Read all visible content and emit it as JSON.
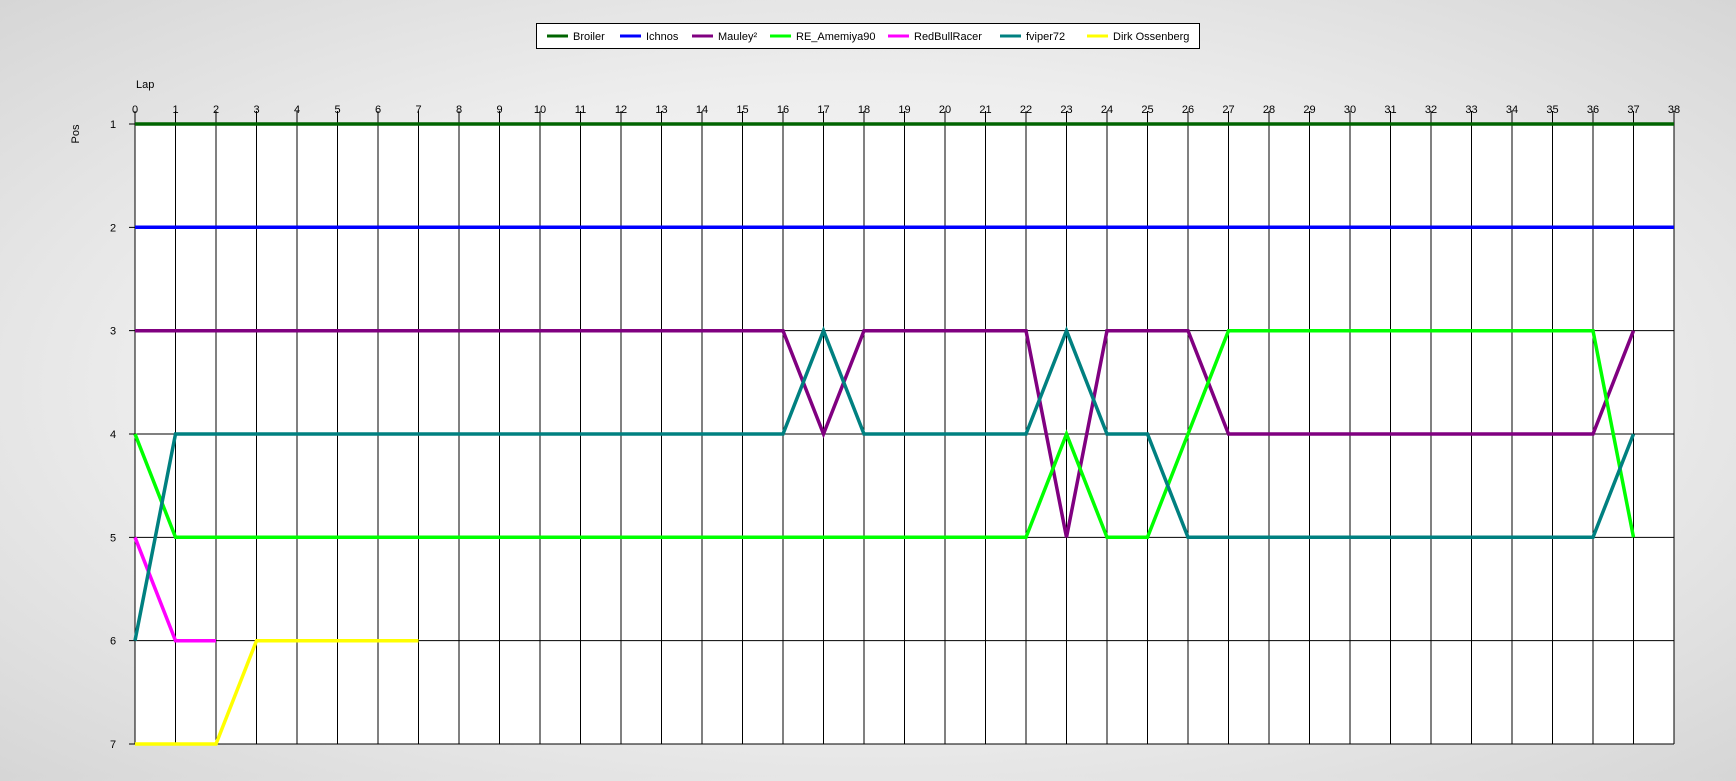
{
  "chart_data": {
    "type": "line",
    "title": "",
    "xlabel": "Lap",
    "ylabel": "Pos",
    "x": [
      0,
      1,
      2,
      3,
      4,
      5,
      6,
      7,
      8,
      9,
      10,
      11,
      12,
      13,
      14,
      15,
      16,
      17,
      18,
      19,
      20,
      21,
      22,
      23,
      24,
      25,
      26,
      27,
      28,
      29,
      30,
      31,
      32,
      33,
      34,
      35,
      36,
      37,
      38
    ],
    "xlim": [
      0,
      38
    ],
    "ylim": [
      1,
      7
    ],
    "y_inverted": true,
    "y_ticks": [
      1,
      2,
      3,
      4,
      5,
      6,
      7
    ],
    "grid": true,
    "legend_position": "top-center",
    "series": [
      {
        "name": "Broiler",
        "color": "#006400",
        "x": [
          0,
          1,
          2,
          3,
          4,
          5,
          6,
          7,
          8,
          9,
          10,
          11,
          12,
          13,
          14,
          15,
          16,
          17,
          18,
          19,
          20,
          21,
          22,
          23,
          24,
          25,
          26,
          27,
          28,
          29,
          30,
          31,
          32,
          33,
          34,
          35,
          36,
          37,
          38
        ],
        "values": [
          1,
          1,
          1,
          1,
          1,
          1,
          1,
          1,
          1,
          1,
          1,
          1,
          1,
          1,
          1,
          1,
          1,
          1,
          1,
          1,
          1,
          1,
          1,
          1,
          1,
          1,
          1,
          1,
          1,
          1,
          1,
          1,
          1,
          1,
          1,
          1,
          1,
          1,
          1
        ]
      },
      {
        "name": "Ichnos",
        "color": "#0000ff",
        "x": [
          0,
          1,
          2,
          3,
          4,
          5,
          6,
          7,
          8,
          9,
          10,
          11,
          12,
          13,
          14,
          15,
          16,
          17,
          18,
          19,
          20,
          21,
          22,
          23,
          24,
          25,
          26,
          27,
          28,
          29,
          30,
          31,
          32,
          33,
          34,
          35,
          36,
          37,
          38
        ],
        "values": [
          2,
          2,
          2,
          2,
          2,
          2,
          2,
          2,
          2,
          2,
          2,
          2,
          2,
          2,
          2,
          2,
          2,
          2,
          2,
          2,
          2,
          2,
          2,
          2,
          2,
          2,
          2,
          2,
          2,
          2,
          2,
          2,
          2,
          2,
          2,
          2,
          2,
          2,
          2
        ]
      },
      {
        "name": "Mauley²",
        "color": "#800080",
        "x": [
          0,
          1,
          2,
          3,
          4,
          5,
          6,
          7,
          8,
          9,
          10,
          11,
          12,
          13,
          14,
          15,
          16,
          17,
          18,
          19,
          20,
          21,
          22,
          23,
          24,
          25,
          26,
          27,
          28,
          29,
          30,
          31,
          32,
          33,
          34,
          35,
          36,
          37
        ],
        "values": [
          3,
          3,
          3,
          3,
          3,
          3,
          3,
          3,
          3,
          3,
          3,
          3,
          3,
          3,
          3,
          3,
          3,
          4,
          3,
          3,
          3,
          3,
          3,
          5,
          3,
          3,
          3,
          4,
          4,
          4,
          4,
          4,
          4,
          4,
          4,
          4,
          4,
          3
        ]
      },
      {
        "name": "RE_Amemiya90",
        "color": "#00ff00",
        "x": [
          0,
          1,
          2,
          3,
          4,
          5,
          6,
          7,
          8,
          9,
          10,
          11,
          12,
          13,
          14,
          15,
          16,
          17,
          18,
          19,
          20,
          21,
          22,
          23,
          24,
          25,
          26,
          27,
          28,
          29,
          30,
          31,
          32,
          33,
          34,
          35,
          36,
          37
        ],
        "values": [
          4,
          5,
          5,
          5,
          5,
          5,
          5,
          5,
          5,
          5,
          5,
          5,
          5,
          5,
          5,
          5,
          5,
          5,
          5,
          5,
          5,
          5,
          5,
          4,
          5,
          5,
          4,
          3,
          3,
          3,
          3,
          3,
          3,
          3,
          3,
          3,
          3,
          5
        ]
      },
      {
        "name": "RedBullRacer",
        "color": "#ff00ff",
        "x": [
          0,
          1,
          2
        ],
        "values": [
          5,
          6,
          6
        ]
      },
      {
        "name": "fviper72",
        "color": "#008080",
        "x": [
          0,
          1,
          2,
          3,
          4,
          5,
          6,
          7,
          8,
          9,
          10,
          11,
          12,
          13,
          14,
          15,
          16,
          17,
          18,
          19,
          20,
          21,
          22,
          23,
          24,
          25,
          26,
          27,
          28,
          29,
          30,
          31,
          32,
          33,
          34,
          35,
          36,
          37
        ],
        "values": [
          6,
          4,
          4,
          4,
          4,
          4,
          4,
          4,
          4,
          4,
          4,
          4,
          4,
          4,
          4,
          4,
          4,
          3,
          4,
          4,
          4,
          4,
          4,
          3,
          4,
          4,
          5,
          5,
          5,
          5,
          5,
          5,
          5,
          5,
          5,
          5,
          5,
          4
        ]
      },
      {
        "name": "Dirk Ossenberg",
        "color": "#ffff00",
        "x": [
          0,
          1,
          2,
          3,
          4,
          5,
          6,
          7
        ],
        "values": [
          7,
          7,
          7,
          6,
          6,
          6,
          6,
          6
        ]
      }
    ]
  }
}
